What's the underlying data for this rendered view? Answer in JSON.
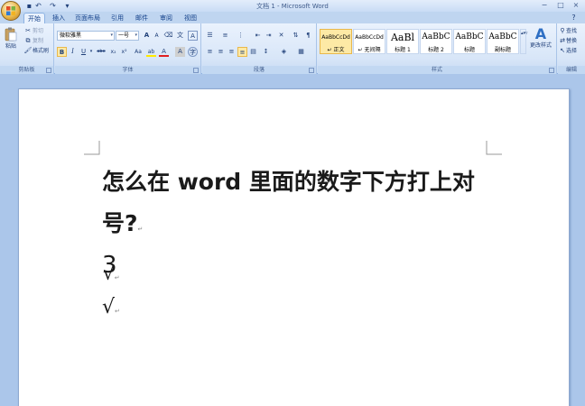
{
  "window": {
    "title": "文档 1 - Microsoft Word",
    "controls": [
      "−",
      "□",
      "×"
    ]
  },
  "quick_access": [
    "save-icon",
    "undo-icon",
    "redo-icon",
    "customize-icon"
  ],
  "tabs": [
    {
      "label": "开始",
      "active": true
    },
    {
      "label": "插入"
    },
    {
      "label": "页面布局"
    },
    {
      "label": "引用"
    },
    {
      "label": "邮件"
    },
    {
      "label": "审阅"
    },
    {
      "label": "视图"
    }
  ],
  "ribbon": {
    "clipboard": {
      "paste_label": "粘贴",
      "cut_label": "剪切",
      "copy_label": "复制",
      "format_painter_label": "格式刷",
      "group_label": "剪贴板"
    },
    "font": {
      "font_name": "微软雅黑",
      "font_size": "一号",
      "grow_label": "A",
      "shrink_label": "A",
      "bold": "B",
      "italic": "I",
      "underline": "U",
      "strike": "abe",
      "subscript": "x₂",
      "superscript": "x²",
      "change_case": "Aa",
      "highlight": "ab",
      "font_color": "A",
      "char_shade": "A",
      "enclose": "字",
      "phonetic": "文",
      "group_label": "字体"
    },
    "paragraph": {
      "group_label": "段落"
    },
    "styles": {
      "items": [
        {
          "preview": "AaBbCcDd",
          "name": "↵ 正文",
          "selected": true
        },
        {
          "preview": "AaBbCcDd",
          "name": "↵ 无间隔"
        },
        {
          "preview": "AaBl",
          "name": "标题 1"
        },
        {
          "preview": "AaBbC",
          "name": "标题 2"
        },
        {
          "preview": "AaBbC",
          "name": "标题"
        },
        {
          "preview": "AaBbC",
          "name": "副标题"
        }
      ],
      "change_styles_label": "更改样式",
      "group_label": "样式"
    },
    "editing": {
      "find_label": "查找",
      "replace_label": "替换",
      "select_label": "选择",
      "group_label": "编辑"
    }
  },
  "document": {
    "heading": "怎么在 word 里面的数字下方打上对号?",
    "digit": "3",
    "check_mark": "√",
    "check_mark_2": "√"
  }
}
